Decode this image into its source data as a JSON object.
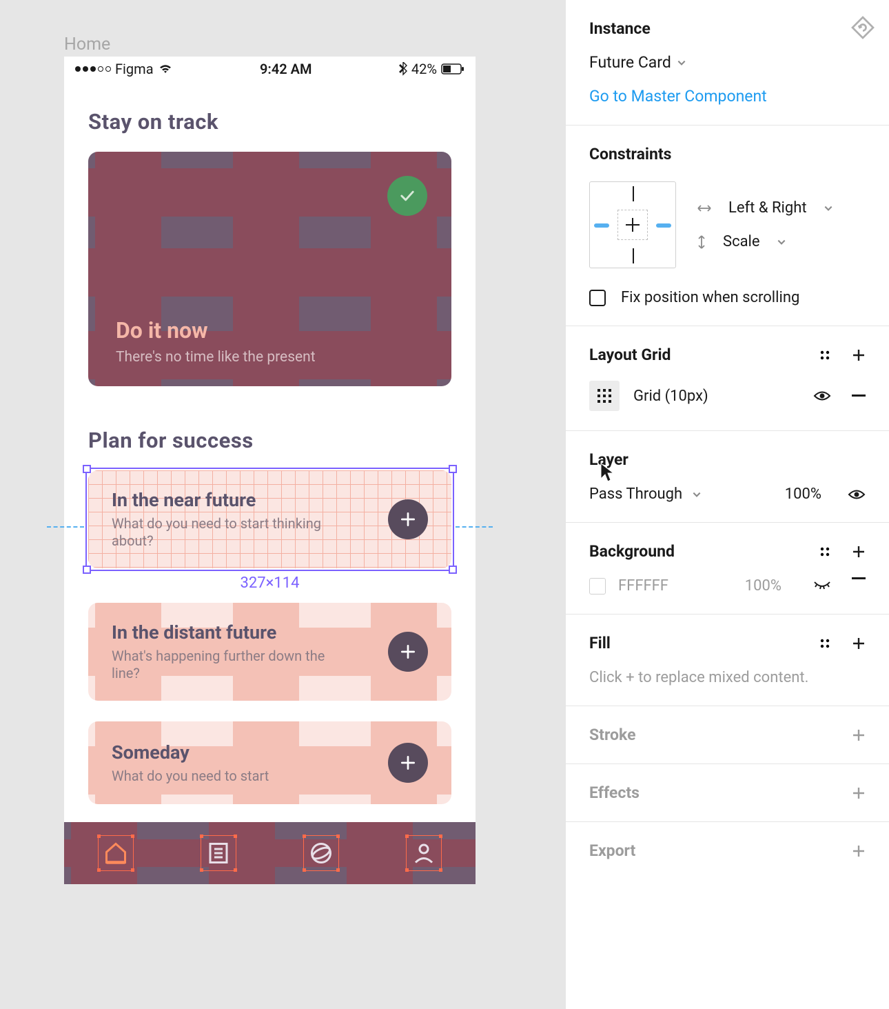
{
  "canvas": {
    "frame_label": "Home",
    "status_bar": {
      "carrier": "Figma",
      "time": "9:42 AM",
      "battery_pct": "42%"
    },
    "section1_title": "Stay on track",
    "hero": {
      "title": "Do it now",
      "subtitle": "There's no time like the present"
    },
    "section2_title": "Plan for success",
    "cards": [
      {
        "title": "In the near future",
        "subtitle": "What do you need to start thinking about?"
      },
      {
        "title": "In the distant future",
        "subtitle": "What's happening further down the line?"
      },
      {
        "title": "Someday",
        "subtitle": "What do you need to start"
      }
    ],
    "selection_dimensions": "327×114"
  },
  "panel": {
    "instance": {
      "title": "Instance",
      "component_name": "Future Card",
      "master_link": "Go to Master Component"
    },
    "constraints": {
      "title": "Constraints",
      "horizontal": "Left & Right",
      "vertical": "Scale",
      "fix_position": "Fix position when scrolling"
    },
    "layout_grid": {
      "title": "Layout Grid",
      "row_label": "Grid (10px)"
    },
    "layer": {
      "title": "Layer",
      "blend_mode": "Pass Through",
      "opacity": "100%"
    },
    "background": {
      "title": "Background",
      "hex": "FFFFFF",
      "opacity": "100%"
    },
    "fill": {
      "title": "Fill",
      "placeholder": "Click + to replace mixed content."
    },
    "stroke_title": "Stroke",
    "effects_title": "Effects",
    "export_title": "Export"
  }
}
